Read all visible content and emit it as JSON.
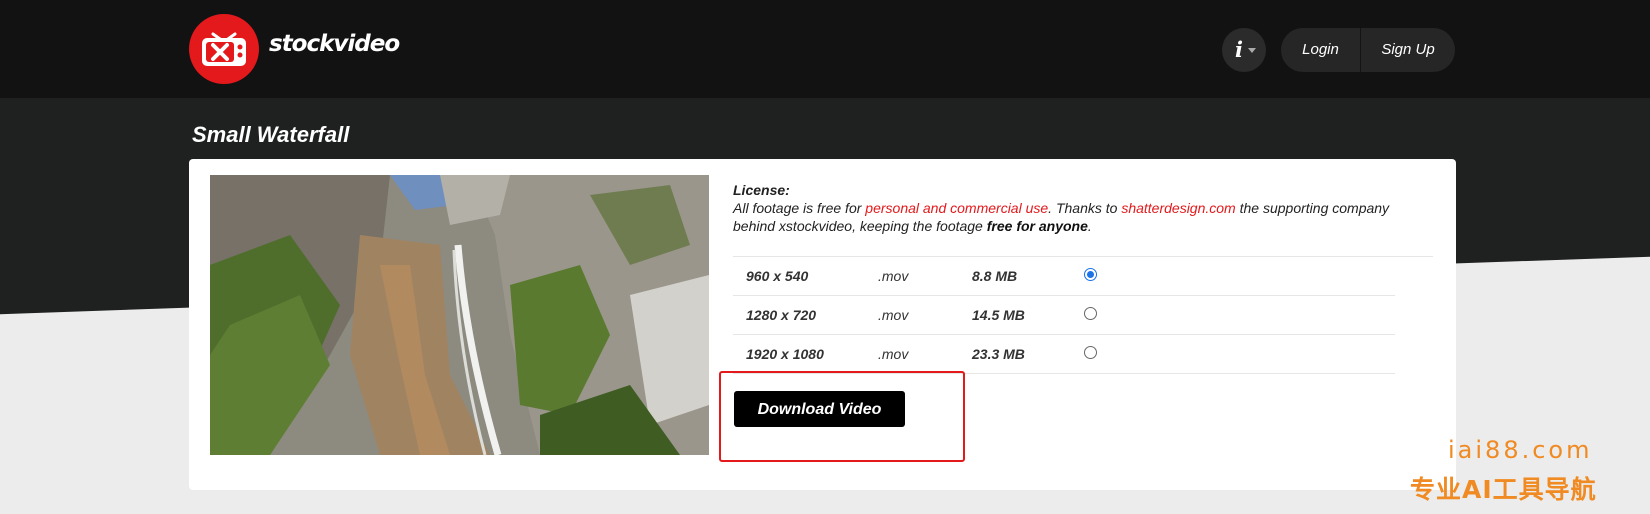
{
  "header": {
    "brand": "stockvideo",
    "info_label": "i",
    "login_label": "Login",
    "signup_label": "Sign Up"
  },
  "page": {
    "title": "Small Waterfall"
  },
  "license": {
    "label": "License:",
    "text_1": "All footage is free for ",
    "link_1": "personal and commercial use",
    "text_2": ". Thanks to ",
    "link_2": "shatterdesign.com",
    "text_3": " the supporting company behind xstockvideo, keeping the footage ",
    "bold": "free for anyone",
    "text_4": "."
  },
  "options": [
    {
      "resolution": "960 x 540",
      "ext": ".mov",
      "size": "8.8 MB",
      "selected": true
    },
    {
      "resolution": "1280 x 720",
      "ext": ".mov",
      "size": "14.5 MB",
      "selected": false
    },
    {
      "resolution": "1920 x 1080",
      "ext": ".mov",
      "size": "23.3 MB",
      "selected": false
    }
  ],
  "download_label": "Download Video",
  "watermark": {
    "line1": "iai88.com",
    "line2": "专业AI工具导航"
  },
  "colors": {
    "brand_red": "#e3191c",
    "header_bg": "#121212",
    "radio_blue": "#1a73e8",
    "watermark_orange": "#f08a22"
  },
  "icons": {
    "logo": "tv-x-logo-icon",
    "info": "info-icon",
    "caret": "caret-down-icon"
  }
}
